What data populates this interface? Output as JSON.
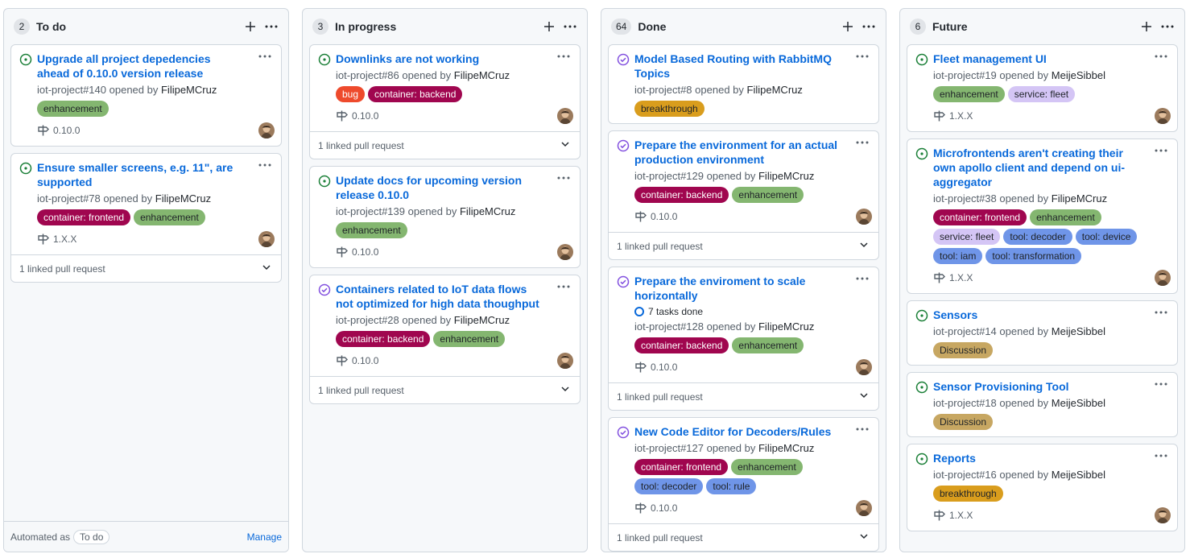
{
  "colors": {
    "open": "#1a7f37",
    "closed": "#8250df",
    "link": "#0969da"
  },
  "label_styles": {
    "enhancement": {
      "bg": "#84b670",
      "fg": "#1f2328"
    },
    "bug": {
      "bg": "#ee4a2c",
      "fg": "#ffffff"
    },
    "container: backend": {
      "bg": "#a0064f",
      "fg": "#ffffff"
    },
    "container: frontend": {
      "bg": "#a0064f",
      "fg": "#ffffff"
    },
    "breakthrough": {
      "bg": "#d99d1d",
      "fg": "#1f2328"
    },
    "service: fleet": {
      "bg": "#d4c5f5",
      "fg": "#1f2328"
    },
    "tool: decoder": {
      "bg": "#6f95e8",
      "fg": "#1f2328"
    },
    "tool: device": {
      "bg": "#6f95e8",
      "fg": "#1f2328"
    },
    "tool: iam": {
      "bg": "#6f95e8",
      "fg": "#1f2328"
    },
    "tool: rule": {
      "bg": "#6f95e8",
      "fg": "#1f2328"
    },
    "tool: transformation": {
      "bg": "#6f95e8",
      "fg": "#1f2328"
    },
    "Discussion": {
      "bg": "#c7a762",
      "fg": "#1f2328"
    }
  },
  "columns": [
    {
      "count": "2",
      "title": "To do",
      "footer": {
        "automated_label": "Automated as",
        "automated_value": "To do",
        "manage_label": "Manage"
      },
      "cards": [
        {
          "state": "open",
          "title": "Upgrade all project depedencies ahead of 0.10.0 version release",
          "ref": "iot-project#140",
          "opened_by": "opened by",
          "user": "FilipeMCruz",
          "labels": [
            "enhancement"
          ],
          "milestone": "0.10.0",
          "pr": ""
        },
        {
          "state": "open",
          "title": "Ensure smaller screens, e.g. 11\", are supported",
          "ref": "iot-project#78",
          "opened_by": "opened by",
          "user": "FilipeMCruz",
          "labels": [
            "container: frontend",
            "enhancement"
          ],
          "milestone": "1.X.X",
          "pr": "1 linked pull request"
        }
      ]
    },
    {
      "count": "3",
      "title": "In progress",
      "cards": [
        {
          "state": "open",
          "title": "Downlinks are not working",
          "ref": "iot-project#86",
          "opened_by": "opened by",
          "user": "FilipeMCruz",
          "labels": [
            "bug",
            "container: backend"
          ],
          "milestone": "0.10.0",
          "pr": "1 linked pull request"
        },
        {
          "state": "open",
          "title": "Update docs for upcoming version release 0.10.0",
          "ref": "iot-project#139",
          "opened_by": "opened by",
          "user": "FilipeMCruz",
          "labels": [
            "enhancement"
          ],
          "milestone": "0.10.0",
          "pr": ""
        },
        {
          "state": "closed",
          "title": "Containers related to IoT data flows not optimized for high data thoughput",
          "ref": "iot-project#28",
          "opened_by": "opened by",
          "user": "FilipeMCruz",
          "labels": [
            "container: backend",
            "enhancement"
          ],
          "milestone": "0.10.0",
          "pr": "1 linked pull request"
        }
      ]
    },
    {
      "count": "64",
      "title": "Done",
      "cards": [
        {
          "state": "closed",
          "title": "Model Based Routing with RabbitMQ Topics",
          "ref": "iot-project#8",
          "opened_by": "opened by",
          "user": "FilipeMCruz",
          "labels": [
            "breakthrough"
          ],
          "milestone": "",
          "pr": ""
        },
        {
          "state": "closed",
          "title": "Prepare the environment for an actual production environment",
          "ref": "iot-project#129",
          "opened_by": "opened by",
          "user": "FilipeMCruz",
          "labels": [
            "container: backend",
            "enhancement"
          ],
          "milestone": "0.10.0",
          "pr": "1 linked pull request"
        },
        {
          "state": "closed",
          "title": "Prepare the enviroment to scale horizontally",
          "tasks": "7 tasks done",
          "ref": "iot-project#128",
          "opened_by": "opened by",
          "user": "FilipeMCruz",
          "labels": [
            "container: backend",
            "enhancement"
          ],
          "milestone": "0.10.0",
          "pr": "1 linked pull request"
        },
        {
          "state": "closed",
          "title": "New Code Editor for Decoders/Rules",
          "ref": "iot-project#127",
          "opened_by": "opened by",
          "user": "FilipeMCruz",
          "labels": [
            "container: frontend",
            "enhancement",
            "tool: decoder",
            "tool: rule"
          ],
          "milestone": "0.10.0",
          "pr": "1 linked pull request"
        }
      ]
    },
    {
      "count": "6",
      "title": "Future",
      "cards": [
        {
          "state": "open",
          "title": "Fleet management UI",
          "ref": "iot-project#19",
          "opened_by": "opened by",
          "user": "MeijeSibbel",
          "labels": [
            "enhancement",
            "service: fleet"
          ],
          "milestone": "1.X.X",
          "pr": ""
        },
        {
          "state": "open",
          "title": "Microfrontends aren't creating their own apollo client and depend on ui-aggregator",
          "ref": "iot-project#38",
          "opened_by": "opened by",
          "user": "FilipeMCruz",
          "labels": [
            "container: frontend",
            "enhancement",
            "service: fleet",
            "tool: decoder",
            "tool: device",
            "tool: iam",
            "tool: transformation"
          ],
          "milestone": "1.X.X",
          "pr": ""
        },
        {
          "state": "open",
          "title": "Sensors",
          "ref": "iot-project#14",
          "opened_by": "opened by",
          "user": "MeijeSibbel",
          "labels": [
            "Discussion"
          ],
          "milestone": "",
          "pr": ""
        },
        {
          "state": "open",
          "title": "Sensor Provisioning Tool",
          "ref": "iot-project#18",
          "opened_by": "opened by",
          "user": "MeijeSibbel",
          "labels": [
            "Discussion"
          ],
          "milestone": "",
          "pr": ""
        },
        {
          "state": "open",
          "title": "Reports",
          "ref": "iot-project#16",
          "opened_by": "opened by",
          "user": "MeijeSibbel",
          "labels": [
            "breakthrough"
          ],
          "milestone": "1.X.X",
          "pr": ""
        }
      ]
    }
  ]
}
